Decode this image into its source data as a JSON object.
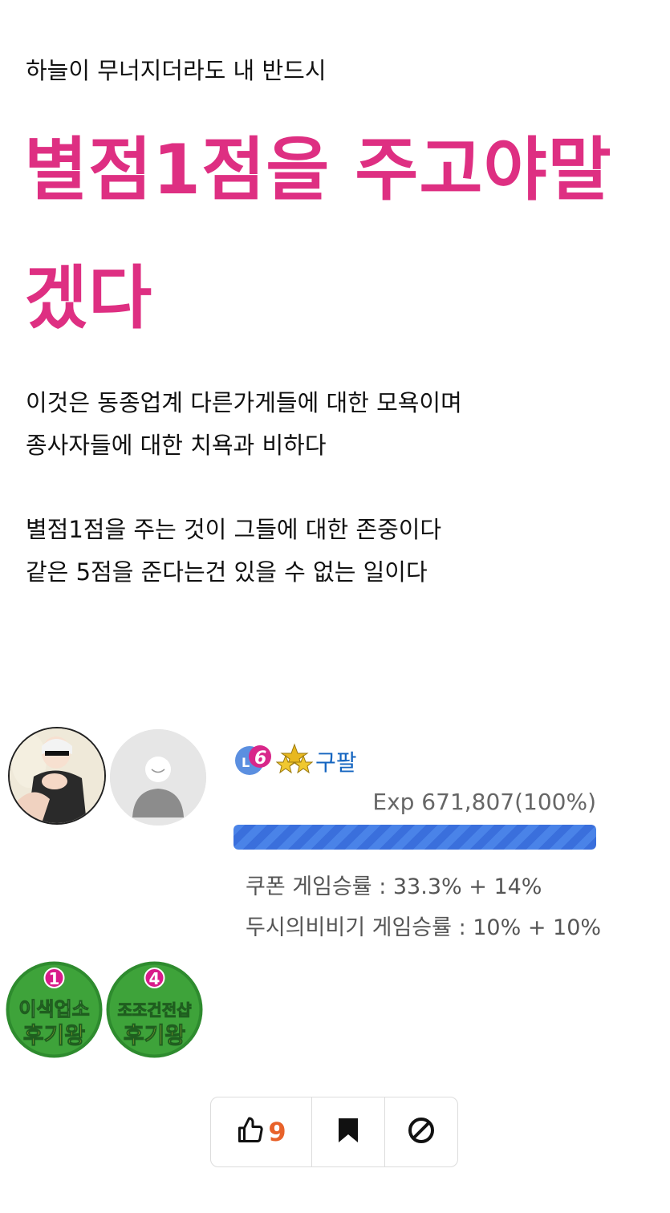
{
  "post": {
    "intro": "하늘이 무너지더라도 내 반드시",
    "headline": "별점1점을 주고야말 겠다",
    "paragraph1": [
      "이것은 동종업계 다른가게들에 대한 모욕이며",
      "종사자들에 대한 치욕과 비하다"
    ],
    "paragraph2": [
      "별점1점을 주는 것이 그들에 대한 존중이다",
      "같은 5점을 준다는건 있을 수 없는 일이다"
    ]
  },
  "author": {
    "level": "6",
    "nickname": "구팔",
    "exp_text": "Exp 671,807(100%)",
    "exp_percent": 100,
    "stats": [
      "쿠폰 게임승률 : 33.3% + 14%",
      "두시의비비기 게임승률 : 10% + 10%"
    ],
    "badges": [
      {
        "rank": "1",
        "line1": "이색업소",
        "line2": "후기왕"
      },
      {
        "rank": "4",
        "line1": "조조건전샵",
        "line2": "후기왕"
      }
    ]
  },
  "actions": {
    "like_count": "9"
  },
  "colors": {
    "headline": "#de2f82",
    "nickname": "#1565c0",
    "like_count": "#e8622a",
    "exp_bar": "#4a83e8",
    "badge_green": "#2e8b2e"
  }
}
